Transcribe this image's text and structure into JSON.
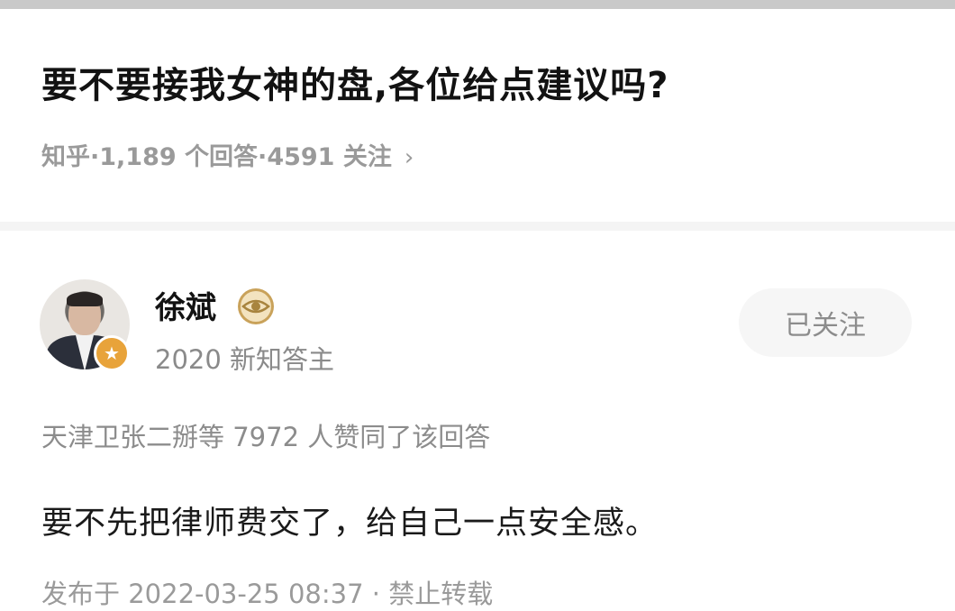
{
  "question": {
    "title": "要不要接我女神的盘,各位给点建议吗?",
    "meta": "知乎·1,189 个回答·4591 关注",
    "meta_chevron": "›"
  },
  "author": {
    "name": "徐斌",
    "description": "2020 新知答主",
    "badge_icon": "★",
    "follow_label": "已关注"
  },
  "answer": {
    "likes_text": "天津卫张二掰等 7972 人赞同了该回答",
    "content": "要不先把律师费交了，给自己一点安全感。",
    "publish_info": "发布于 2022-03-25 08:37 · 禁止转载"
  },
  "colors": {
    "title": "#121212",
    "muted": "#8c8c8c",
    "badge": "#e8a33a",
    "level_icon": "#c9a25a"
  }
}
